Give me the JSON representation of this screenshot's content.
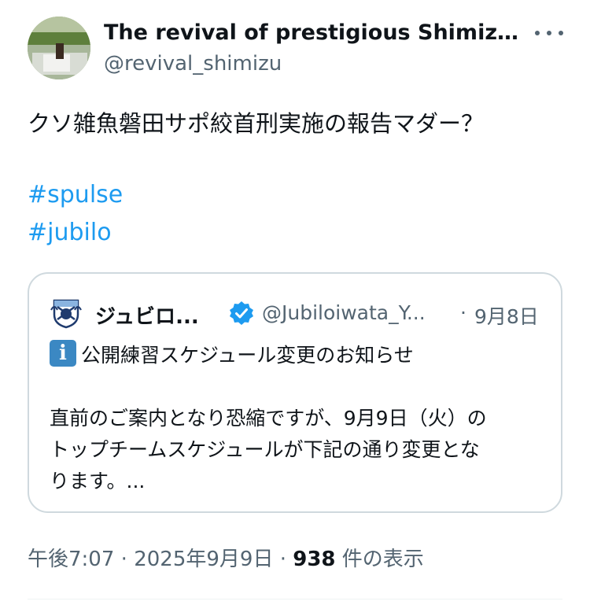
{
  "author": {
    "display_name": "The revival of prestigious Shimizu ...",
    "handle": "@revival_shimizu",
    "avatar": "avatar-photo"
  },
  "more_icon": "more-horizontal-icon",
  "tweet": {
    "text": "クソ雑魚磐田サポ絞首刑実施の報告マダー？",
    "hashtags": [
      "#spulse",
      "#jubilo"
    ]
  },
  "quote": {
    "name": "ジュビロ...",
    "verified_icon": "verified-badge-icon",
    "handle": "@Jubiloiwata_Y...",
    "separator": "·",
    "date": "9月8日",
    "info_icon_glyph": "i",
    "title": "公開練習スケジュール変更のお知らせ",
    "body_lines": [
      "直前のご案内となり恐縮ですが、9月9日（火）の",
      "トップチームスケジュールが下記の通り変更とな",
      "ります。..."
    ]
  },
  "meta": {
    "time": "午後7:07",
    "sep1": " · ",
    "date": "2025年9月9日",
    "sep2": " · ",
    "views": "938",
    "views_label": " 件の表示"
  },
  "colors": {
    "link": "#1d9bf0",
    "secondary_text": "#536471",
    "verified": "#1d9bf0",
    "info_icon": "#3b88c3"
  }
}
